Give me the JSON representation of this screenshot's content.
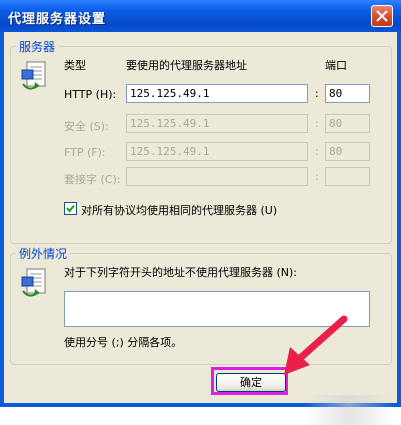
{
  "dialog": {
    "title": "代理服务器设置",
    "close_icon": "close-icon"
  },
  "servers": {
    "legend": "服务器",
    "col_type": "类型",
    "col_address": "要使用的代理服务器地址",
    "col_port": "端口",
    "rows": [
      {
        "label": "HTTP (H):",
        "address": "125.125.49.1",
        "port": "80",
        "enabled": true
      },
      {
        "label": "安全 (S):",
        "address": "125.125.49.1",
        "port": "80",
        "enabled": false
      },
      {
        "label": "FTP (F):",
        "address": "125.125.49.1",
        "port": "80",
        "enabled": false
      },
      {
        "label": "套接字 (C):",
        "address": "",
        "port": "",
        "enabled": false
      }
    ],
    "same_proxy_checked": true,
    "same_proxy_label": "对所有协议均使用相同的代理服务器 (U)"
  },
  "exceptions": {
    "legend": "例外情况",
    "description": "对于下列字符开头的地址不使用代理服务器 (N):",
    "value": "",
    "hint": "使用分号 (;) 分隔各项。"
  },
  "buttons": {
    "ok_label": "确定"
  },
  "colors": {
    "title_bar": "#0a54d8",
    "legend_text": "#0046d5",
    "highlight": "#e020e0",
    "arrow": "#e8204a"
  }
}
